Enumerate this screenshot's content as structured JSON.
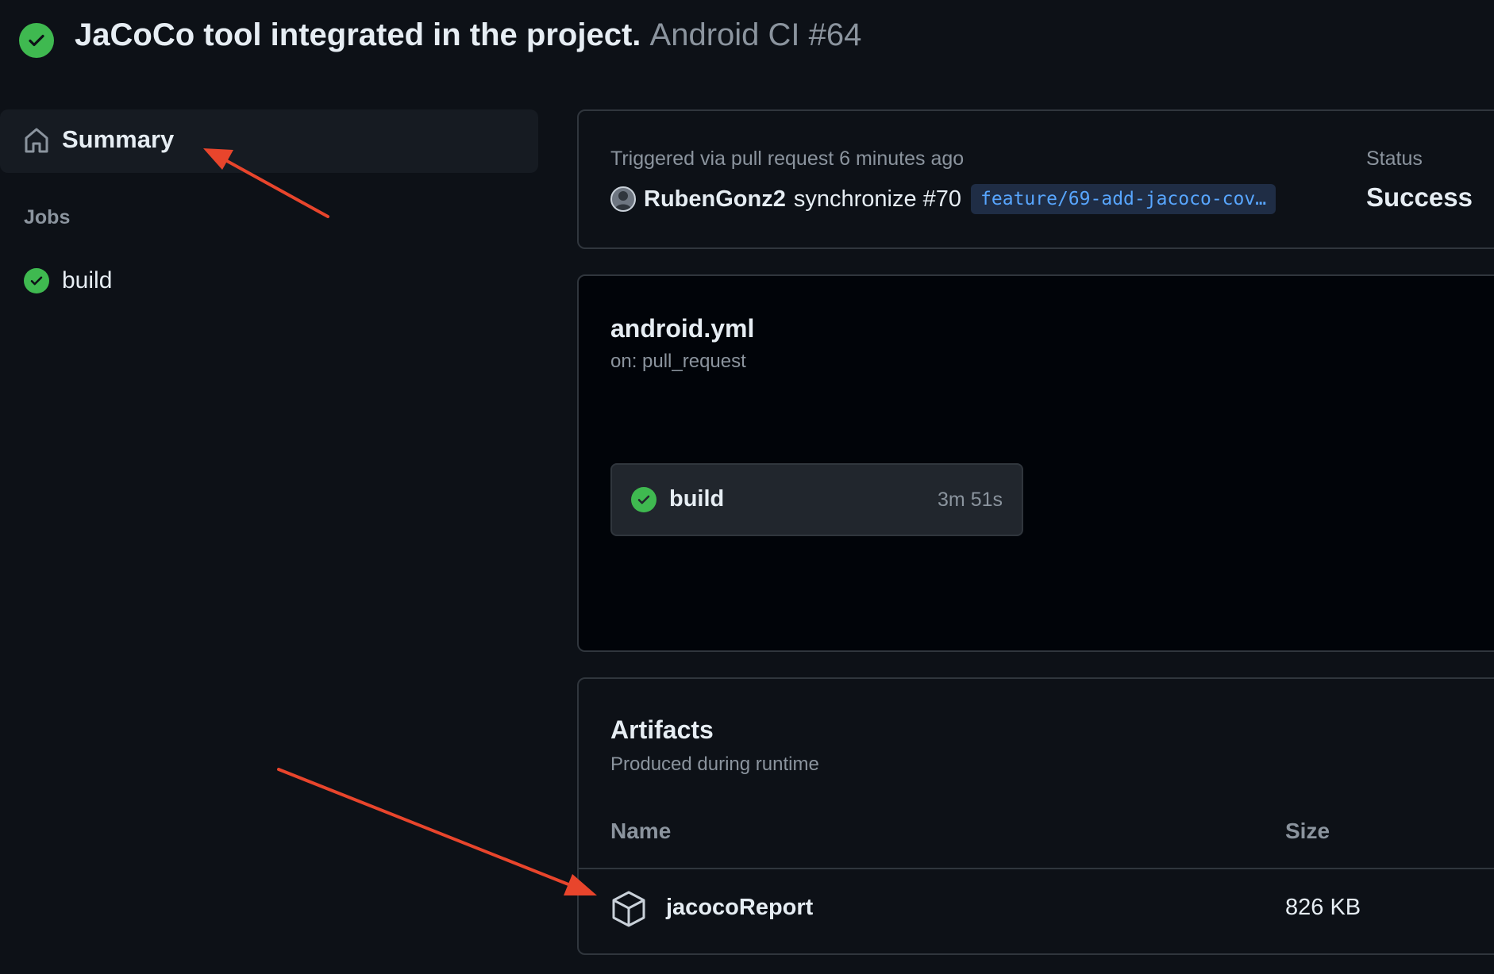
{
  "header": {
    "title": "JaCoCo tool integrated in the project.",
    "workflow_run": "Android CI #64",
    "status_icon": "check-circle-icon"
  },
  "sidebar": {
    "summary_label": "Summary",
    "summary_icon": "home-icon",
    "jobs_heading": "Jobs",
    "jobs": [
      {
        "label": "build",
        "icon": "check-circle-icon"
      }
    ]
  },
  "trigger": {
    "text": "Triggered via pull request 6 minutes ago",
    "actor": "RubenGonz2",
    "event": "synchronize #70",
    "branch": "feature/69-add-jacoco-cov…",
    "status_label": "Status",
    "status_value": "Success"
  },
  "workflow": {
    "file": "android.yml",
    "on": "on: pull_request",
    "jobs": [
      {
        "name": "build",
        "duration": "3m 51s"
      }
    ]
  },
  "artifacts": {
    "title": "Artifacts",
    "subtitle": "Produced during runtime",
    "columns": [
      "Name",
      "Size"
    ],
    "items": [
      {
        "name": "jacocoReport",
        "size": "826 KB",
        "icon": "package-icon"
      }
    ]
  },
  "colors": {
    "background": "#0d1117",
    "success": "#3fb950",
    "annotation_arrow": "#e8452c",
    "branch_link": "#58a6ff"
  }
}
